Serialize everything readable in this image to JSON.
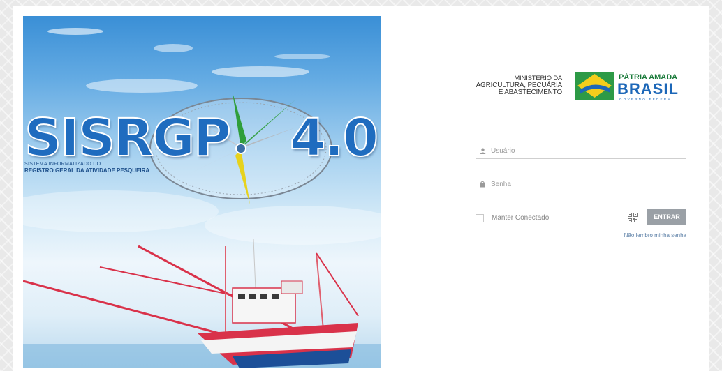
{
  "hero": {
    "logo_main": "SISRGP",
    "logo_version": "4.0",
    "logo_subtitle_1": "SISTEMA INFORMATIZADO DO",
    "logo_subtitle_2": "REGISTRO GERAL DA ATIVIDADE PESQUEIRA"
  },
  "header": {
    "ministry_line_1": "MINISTÉRIO DA",
    "ministry_line_2": "AGRICULTURA, PECUÁRIA",
    "ministry_line_3": "E ABASTECIMENTO",
    "brand_top": "PÁTRIA AMADA",
    "brand_main": "BRASIL",
    "brand_bottom": "GOVERNO FEDERAL"
  },
  "login": {
    "username_placeholder": "Usuário",
    "password_placeholder": "Senha",
    "keep_connected_label": "Manter Conectado",
    "enter_button_label": "ENTRAR",
    "forgot_password_link": "Não lembro minha senha"
  },
  "icons": {
    "user": "user-icon",
    "lock": "lock-icon",
    "qr": "qr-code-icon"
  },
  "colors": {
    "logo_blue": "#1f6cbf",
    "enter_button_bg": "#9aa0a6",
    "link": "#5b7fa6",
    "brasil_green": "#1a7a3a",
    "brasil_blue": "#1c67b8"
  }
}
